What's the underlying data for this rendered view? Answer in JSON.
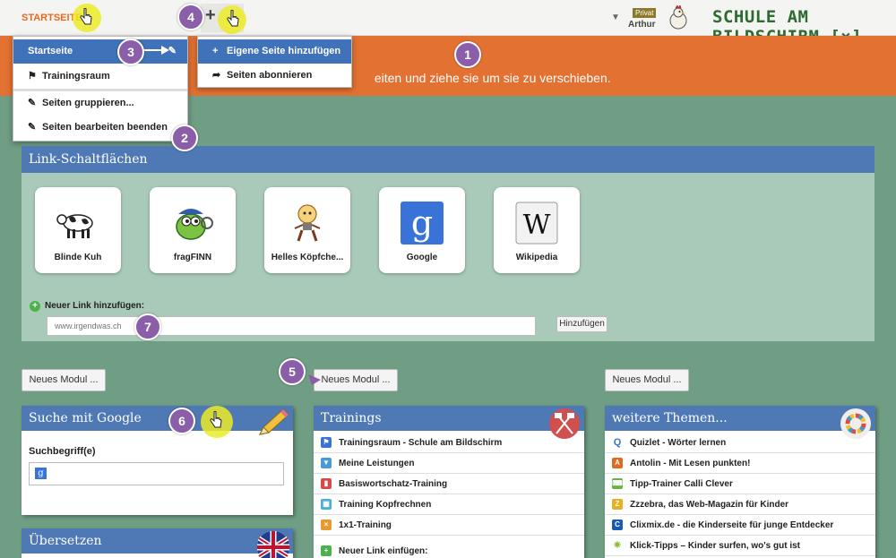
{
  "topbar": {
    "start_tab": "STARTSEITE",
    "plus": "+",
    "user_badge": "Privat",
    "user_name": "Arthur",
    "logo_text": "SCHULE AM BILDSCHIRM [×]"
  },
  "banner": {
    "text": "d                                                      eiten und ziehe sie um sie zu verschieben."
  },
  "menu_left": {
    "items": [
      {
        "label": "Startseite",
        "icon": "pencil-icon"
      },
      {
        "label": "Trainingsraum",
        "icon": "flag-icon"
      },
      {
        "label": "Seiten gruppieren...",
        "icon": "pencil-icon"
      },
      {
        "label": "Seiten bearbeiten beenden",
        "icon": "pencil-icon"
      }
    ]
  },
  "menu_right": {
    "items": [
      {
        "label": "Eigene Seite hinzufügen",
        "icon": "plus-icon"
      },
      {
        "label": "Seiten abonnieren",
        "icon": "share-arrow-icon"
      }
    ]
  },
  "badges": [
    "1",
    "2",
    "3",
    "4",
    "5",
    "6",
    "7"
  ],
  "links_panel": {
    "title": "Link-Schaltflächen",
    "tiles": [
      {
        "label": "Blinde Kuh"
      },
      {
        "label": "fragFINN"
      },
      {
        "label": "Helles Köpfche..."
      },
      {
        "label": "Google"
      },
      {
        "label": "Wikipedia"
      }
    ],
    "new_link_label": "Neuer Link hinzufügen:",
    "url_placeholder": "www.irgendwas.ch",
    "add_button": "Hinzufügen"
  },
  "new_module_button": "Neues Modul ...",
  "google_module": {
    "title": "Suche mit Google",
    "search_label": "Suchbegriff(e)"
  },
  "translate_module": {
    "title": "Übersetzen"
  },
  "trainings_module": {
    "title": "Trainings",
    "items": [
      "Trainingsraum - Schule am Bildschirm",
      "Meine Leistungen",
      "Basiswortschatz-Training",
      "Training Kopfrechnen",
      "1x1-Training"
    ],
    "new_link": "Neuer Link einfügen:"
  },
  "themes_module": {
    "title": "weitere Themen...",
    "items": [
      "Quizlet - Wörter lernen",
      "Antolin - Mit Lesen punkten!",
      "Tipp-Trainer Calli Clever",
      "Zzzebra, das Web-Magazin für Kinder",
      "Clixmix.de - die Kinderseite für junge Entdecker",
      "Klick-Tipps – Kinder surfen, wo's gut ist"
    ]
  },
  "colors": {
    "accent_orange": "#e27132",
    "panel_blue": "#4f79b4",
    "background_green": "#6f9e84",
    "badge_purple": "#8a5ea8",
    "highlight_yellow": "#ebeb28"
  }
}
